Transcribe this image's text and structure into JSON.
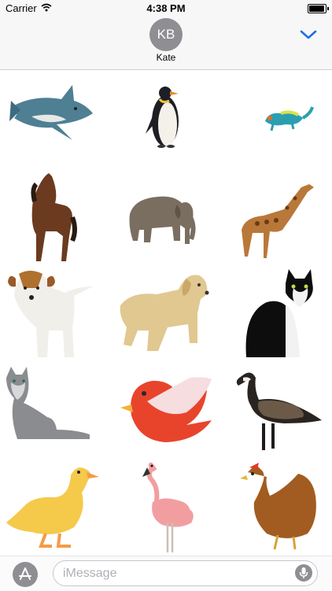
{
  "status_bar": {
    "carrier": "Carrier",
    "time": "4:38 PM",
    "battery_level": 0.95,
    "wifi_icon": "wifi-icon"
  },
  "header": {
    "initials": "KB",
    "contact_name": "Kate",
    "collapse_icon": "chevron-down-icon",
    "accent_color": "#1e6fe3"
  },
  "stickers": [
    "shark",
    "penguin",
    "chameleon",
    "horse",
    "elephant",
    "giraffe",
    "jack-russell-terrier",
    "labrador",
    "tuxedo-cat",
    "gray-cat",
    "red-bird",
    "canada-goose",
    "duckling",
    "flamingo",
    "hen"
  ],
  "composer": {
    "placeholder": "iMessage",
    "app_icon": "app-store-icon",
    "mic_icon": "microphone-icon"
  }
}
